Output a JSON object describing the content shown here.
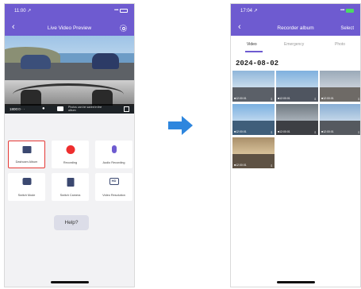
{
  "left_phone": {
    "status_time": "11:00 ↗",
    "status_signal": "••••",
    "title": "Live Video Preview",
    "back_glyph": "‹",
    "preview_controls": {
      "resolution": "1800:0 · ·",
      "hint": "Photos can be saved in the album"
    },
    "tiles": [
      {
        "label": "Dashcam Album",
        "icon": "album-icon"
      },
      {
        "label": "Recording",
        "icon": "record-icon"
      },
      {
        "label": "Audio Recording",
        "icon": "microphone-icon"
      },
      {
        "label": "Switch Mode",
        "icon": "camera-icon"
      },
      {
        "label": "Switch Camera",
        "icon": "switch-camera-icon"
      },
      {
        "label": "Video Resolution",
        "icon": "resolution-icon"
      }
    ],
    "resolution_badge": "HD",
    "help_label": "Help?"
  },
  "right_phone": {
    "status_time": "17:04 ↗",
    "title": "Recorder album",
    "select_label": "Select",
    "back_glyph": "‹",
    "tabs": [
      "Video",
      "Emergency",
      "Photo"
    ],
    "active_tab": "Video",
    "date_header": "2024-08-02",
    "thumbnails": [
      {
        "caption": "■12:00:01"
      },
      {
        "caption": "■12:00:01"
      },
      {
        "caption": "■12:00:01"
      },
      {
        "caption": "■12:00:01"
      },
      {
        "caption": "■12:00:01"
      },
      {
        "caption": "■12:00:01"
      },
      {
        "caption": "■12:00:01"
      }
    ]
  },
  "colors": {
    "accent": "#6e5bd0",
    "record": "#ee2e2e",
    "highlight": "#e53935",
    "arrow": "#2e86de"
  }
}
